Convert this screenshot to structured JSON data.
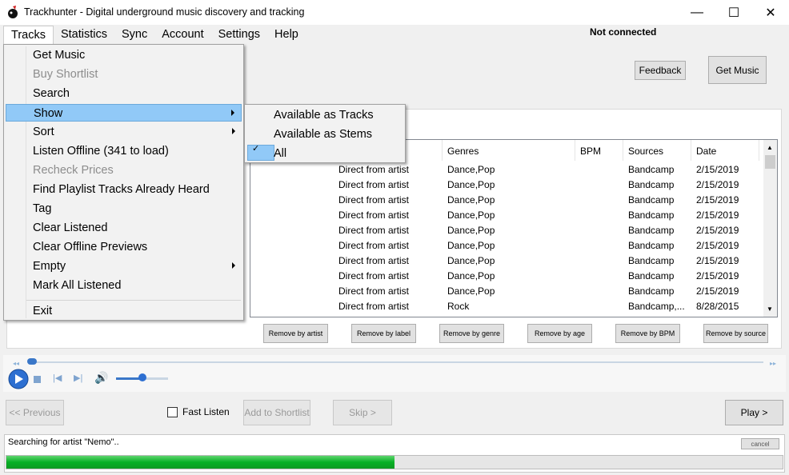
{
  "window": {
    "title": "Trackhunter - Digital underground music discovery and tracking",
    "controls": {
      "minimize": "—",
      "maximize": "☐",
      "close": "✕"
    }
  },
  "menubar": {
    "items": [
      "Tracks",
      "Statistics",
      "Sync",
      "Account",
      "Settings",
      "Help"
    ],
    "active": "Tracks"
  },
  "status": {
    "connection": "Not connected"
  },
  "top_buttons": {
    "feedback": "Feedback",
    "get_music": "Get Music"
  },
  "tracks_menu": {
    "items": [
      {
        "label": "Get Music",
        "enabled": true
      },
      {
        "label": "Buy Shortlist",
        "enabled": false
      },
      {
        "label": "Search",
        "enabled": true
      },
      {
        "label": "Show",
        "enabled": true,
        "submenu": true,
        "highlighted": true
      },
      {
        "label": "Sort",
        "enabled": true,
        "submenu": true
      },
      {
        "label": "Listen Offline (341 to load)",
        "enabled": true
      },
      {
        "label": "Recheck Prices",
        "enabled": false
      },
      {
        "label": "Find Playlist Tracks Already Heard",
        "enabled": true
      },
      {
        "label": "Tag",
        "enabled": true
      },
      {
        "label": "Clear Listened",
        "enabled": true
      },
      {
        "label": "Clear Offline Previews",
        "enabled": true
      },
      {
        "label": "Empty",
        "enabled": true,
        "submenu": true
      },
      {
        "label": "Mark All Listened",
        "enabled": true
      },
      {
        "label": "Exit",
        "enabled": true
      }
    ]
  },
  "show_submenu": {
    "items": [
      {
        "label": "Available as Tracks",
        "checked": false
      },
      {
        "label": "Available as Stems",
        "checked": false
      },
      {
        "label": "All",
        "checked": true
      }
    ]
  },
  "grid": {
    "columns": [
      "",
      "Genres",
      "BPM",
      "Sources",
      "Date"
    ],
    "rows": [
      [
        "Direct from artist",
        "Dance,Pop",
        "",
        "Bandcamp",
        "2/15/2019"
      ],
      [
        "Direct from artist",
        "Dance,Pop",
        "",
        "Bandcamp",
        "2/15/2019"
      ],
      [
        "Direct from artist",
        "Dance,Pop",
        "",
        "Bandcamp",
        "2/15/2019"
      ],
      [
        "Direct from artist",
        "Dance,Pop",
        "",
        "Bandcamp",
        "2/15/2019"
      ],
      [
        "Direct from artist",
        "Dance,Pop",
        "",
        "Bandcamp",
        "2/15/2019"
      ],
      [
        "Direct from artist",
        "Dance,Pop",
        "",
        "Bandcamp",
        "2/15/2019"
      ],
      [
        "Direct from artist",
        "Dance,Pop",
        "",
        "Bandcamp",
        "2/15/2019"
      ],
      [
        "Direct from artist",
        "Dance,Pop",
        "",
        "Bandcamp",
        "2/15/2019"
      ],
      [
        "Direct from artist",
        "Dance,Pop",
        "",
        "Bandcamp",
        "2/15/2019"
      ],
      [
        "Direct from artist",
        "Rock",
        "",
        "Bandcamp,...",
        "8/28/2015"
      ]
    ]
  },
  "remove_buttons": [
    "Remove by artist",
    "Remove by label",
    "Remove by genre",
    "Remove by age",
    "Remove by BPM",
    "Remove by source"
  ],
  "player": {
    "icons": [
      "play-icon",
      "stop-icon",
      "previous-icon",
      "next-icon",
      "volume-icon"
    ],
    "volume_level": 0.5
  },
  "controls": {
    "previous": "<< Previous",
    "fast_listen": "Fast Listen",
    "add_to_shortlist": "Add to Shortlist",
    "skip": "Skip >",
    "play": "Play >"
  },
  "progress": {
    "status": "Searching for artist \"Nemo\"..",
    "cancel": "cancel",
    "fraction": 0.5
  },
  "colors": {
    "menu_highlight": "#91c9f7",
    "progress": "#06b025"
  }
}
